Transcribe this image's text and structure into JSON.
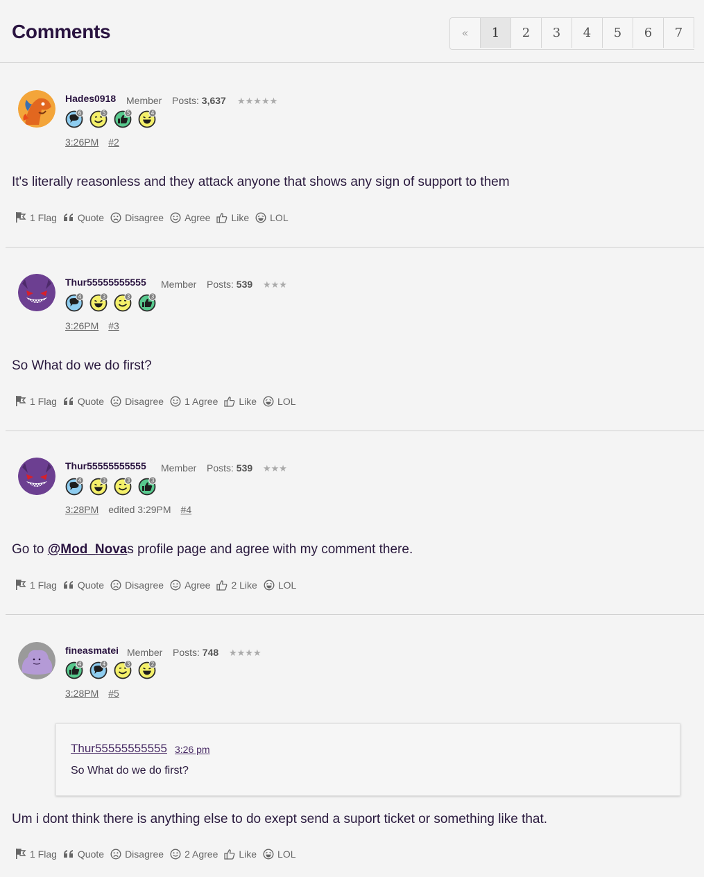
{
  "header": {
    "title": "Comments"
  },
  "pagination": {
    "prev": "«",
    "pages": [
      "1",
      "2",
      "3",
      "4",
      "5",
      "6",
      "7"
    ],
    "active": "1"
  },
  "labels": {
    "posts": "Posts:"
  },
  "comments": [
    {
      "username": "Hades0918",
      "role": "Member",
      "posts": "3,637",
      "stars": "★★★★★",
      "time": "3:26PM",
      "edited": "",
      "num": "#2",
      "badges": [
        {
          "icon": "comment-badge-icon",
          "count": "6"
        },
        {
          "icon": "agree-badge-icon",
          "count": "5"
        },
        {
          "icon": "like-badge-icon",
          "count": "5"
        },
        {
          "icon": "lol-badge-icon",
          "count": "4"
        }
      ],
      "text": "It's literally reasonless and they attack anyone that shows any sign of support to them",
      "actions": {
        "flag": "1 Flag",
        "quote": "Quote",
        "disagree": "Disagree",
        "agree": "Agree",
        "like": "Like",
        "lol": "LOL"
      }
    },
    {
      "username": "Thur55555555555",
      "role": "Member",
      "posts": "539",
      "stars": "★★★",
      "time": "3:26PM",
      "edited": "",
      "num": "#3",
      "badges": [
        {
          "icon": "comment-badge-icon",
          "count": "4"
        },
        {
          "icon": "lol-badge-icon",
          "count": "3"
        },
        {
          "icon": "agree-badge-icon",
          "count": "3"
        },
        {
          "icon": "like-badge-icon",
          "count": "3"
        }
      ],
      "text": "So What do we do first?",
      "actions": {
        "flag": "1 Flag",
        "quote": "Quote",
        "disagree": "Disagree",
        "agree": "1 Agree",
        "like": "Like",
        "lol": "LOL"
      }
    },
    {
      "username": "Thur55555555555",
      "role": "Member",
      "posts": "539",
      "stars": "★★★",
      "time": "3:28PM",
      "edited": "edited 3:29PM",
      "num": "#4",
      "badges": [
        {
          "icon": "comment-badge-icon",
          "count": "4"
        },
        {
          "icon": "lol-badge-icon",
          "count": "3"
        },
        {
          "icon": "agree-badge-icon",
          "count": "3"
        },
        {
          "icon": "like-badge-icon",
          "count": "3"
        }
      ],
      "text_pre": "Go to ",
      "mention": "@Mod_Nova",
      "text_post": "s profile page and agree with my comment there.",
      "actions": {
        "flag": "1 Flag",
        "quote": "Quote",
        "disagree": "Disagree",
        "agree": "Agree",
        "like": "2 Like",
        "lol": "LOL"
      }
    },
    {
      "username": "fineasmatei",
      "role": "Member",
      "posts": "748",
      "stars": "★★★★",
      "time": "3:28PM",
      "edited": "",
      "num": "#5",
      "badges": [
        {
          "icon": "like-badge-icon",
          "count": "4"
        },
        {
          "icon": "comment-badge-icon",
          "count": "4"
        },
        {
          "icon": "agree-badge-icon",
          "count": "3"
        },
        {
          "icon": "lol-badge-icon",
          "count": "2"
        }
      ],
      "quote": {
        "author": "Thur55555555555",
        "time": "3:26 pm",
        "text": "So What do we do first?"
      },
      "text": "Um i dont think there is anything else to do exept send a suport ticket or something like that.",
      "actions": {
        "flag": "1 Flag",
        "quote": "Quote",
        "disagree": "Disagree",
        "agree": "2 Agree",
        "like": "Like",
        "lol": "LOL"
      }
    }
  ]
}
